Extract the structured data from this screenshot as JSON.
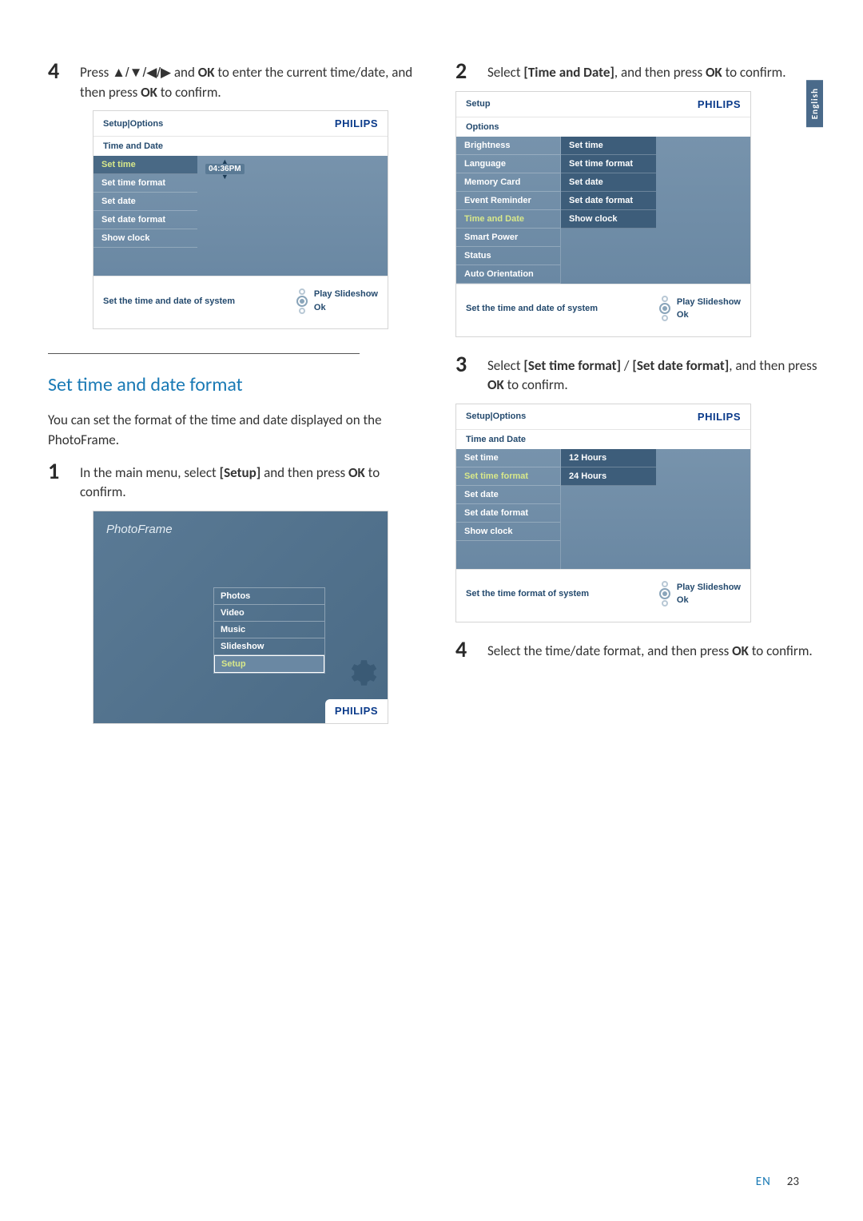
{
  "sideTab": "English",
  "left": {
    "step4": {
      "num": "4",
      "text_a": "Press ",
      "arrows": "▲/▼/◀/▶",
      "text_b": " and ",
      "ok1": "OK",
      "text_c": " to enter the current time/date, and then press ",
      "ok2": "OK",
      "text_d": " to confirm."
    },
    "shot1": {
      "header": "Setup|Options",
      "brand": "PHILIPS",
      "sub": "Time and Date",
      "col1": [
        "Set time",
        "Set time format",
        "Set date",
        "Set date format",
        "Show clock"
      ],
      "spinnerVal": "04:36PM",
      "footer_hint": "Set the time and date of system",
      "nav1": "Play Slideshow",
      "nav2": "Ok"
    },
    "section_title": "Set time and date format",
    "section_para": "You can set the format of the time and date displayed on the PhotoFrame.",
    "step1": {
      "num": "1",
      "text_a": "In the main menu, select ",
      "bold1": "[Setup]",
      "text_b": " and then press ",
      "ok": "OK",
      "text_c": " to confirm."
    },
    "shot2": {
      "title": "PhotoFrame",
      "items": [
        "Photos",
        "Video",
        "Music",
        "Slideshow",
        "Setup"
      ],
      "brand": "PHILIPS"
    }
  },
  "right": {
    "step2": {
      "num": "2",
      "text_a": "Select ",
      "bold1": "[Time and Date]",
      "text_b": ", and then press ",
      "ok": "OK",
      "text_c": " to confirm."
    },
    "shot3": {
      "header": "Setup",
      "brand": "PHILIPS",
      "sub": "Options",
      "col1": [
        "Brightness",
        "Language",
        "Memory Card",
        "Event Reminder",
        "Time and Date",
        "Smart Power",
        "Status",
        "Auto Orientation"
      ],
      "col2": [
        "Set time",
        "Set time format",
        "Set date",
        "Set date format",
        "Show clock"
      ],
      "footer_hint": "Set the time and date of system",
      "nav1": "Play Slideshow",
      "nav2": "Ok"
    },
    "step3": {
      "num": "3",
      "text_a": "Select ",
      "bold1": "[Set time format]",
      "slash": " / ",
      "bold2": "[Set date format]",
      "text_b": ", and then press ",
      "ok": "OK",
      "text_c": " to confirm."
    },
    "shot4": {
      "header": "Setup|Options",
      "brand": "PHILIPS",
      "sub": "Time and Date",
      "col1": [
        "Set time",
        "Set time format",
        "Set date",
        "Set date format",
        "Show clock"
      ],
      "col2": [
        "12 Hours",
        "24 Hours"
      ],
      "footer_hint": "Set the time format of system",
      "nav1": "Play Slideshow",
      "nav2": "Ok"
    },
    "step4b": {
      "num": "4",
      "text_a": "Select the time/date format, and then press ",
      "ok": "OK",
      "text_b": " to confirm."
    }
  },
  "footer": {
    "en": "EN",
    "pg": "23"
  }
}
